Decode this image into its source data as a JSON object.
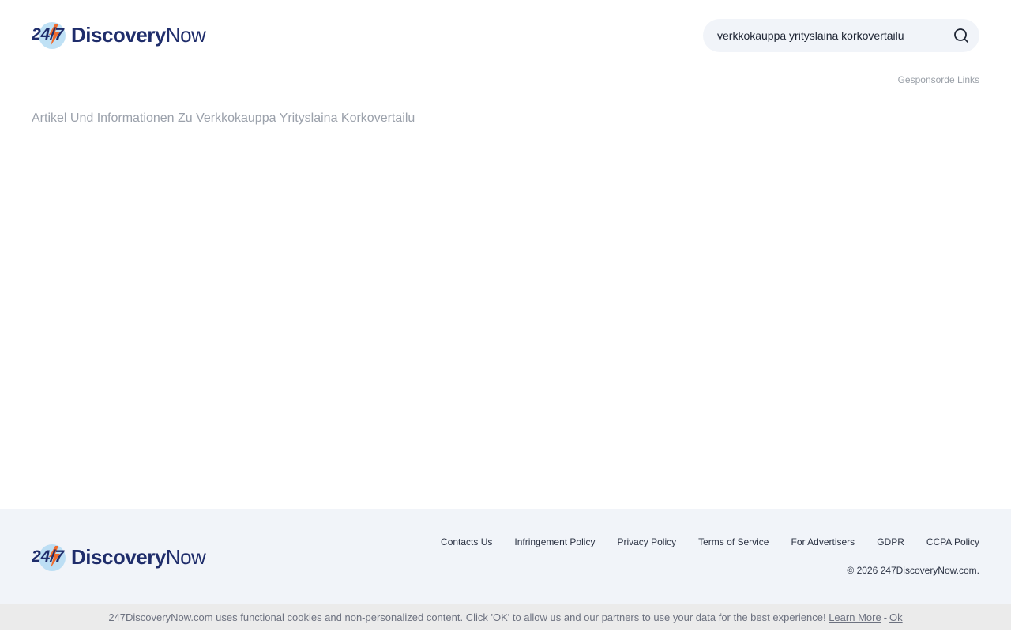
{
  "header": {
    "logo": {
      "mark": "24/7",
      "text_bold": "Discovery",
      "text_light": "Now"
    },
    "search": {
      "value": "verkkokauppa yrityslaina korkovertailu",
      "placeholder": ""
    },
    "sponsored_label": "Gesponsorde Links"
  },
  "main": {
    "heading": "Artikel Und Informationen Zu Verkkokauppa Yrityslaina Korkovertailu"
  },
  "footer": {
    "logo": {
      "mark": "24/7",
      "text_bold": "Discovery",
      "text_light": "Now"
    },
    "links": [
      {
        "label": "Contacts Us"
      },
      {
        "label": "Infringement Policy"
      },
      {
        "label": "Privacy Policy"
      },
      {
        "label": "Terms of Service"
      },
      {
        "label": "For Advertisers"
      },
      {
        "label": "GDPR"
      },
      {
        "label": "CCPA Policy"
      }
    ],
    "copyright": "© 2026 247DiscoveryNow.com."
  },
  "cookie": {
    "message": "247DiscoveryNow.com uses functional cookies and non-personalized content. Click 'OK' to allow us and our partners to use your data for the best experience!",
    "learn_more": "Learn More",
    "separator": "-",
    "ok": "Ok"
  },
  "colors": {
    "brand_navy": "#1f2d6b",
    "brand_orange": "#f06a2b",
    "brand_light_blue": "#a9d7f2",
    "footer_bg": "#f1f4f9",
    "cookie_bg": "#ebebeb"
  },
  "icons": {
    "search": "search-icon",
    "logo": "logo-bolt-icon"
  }
}
